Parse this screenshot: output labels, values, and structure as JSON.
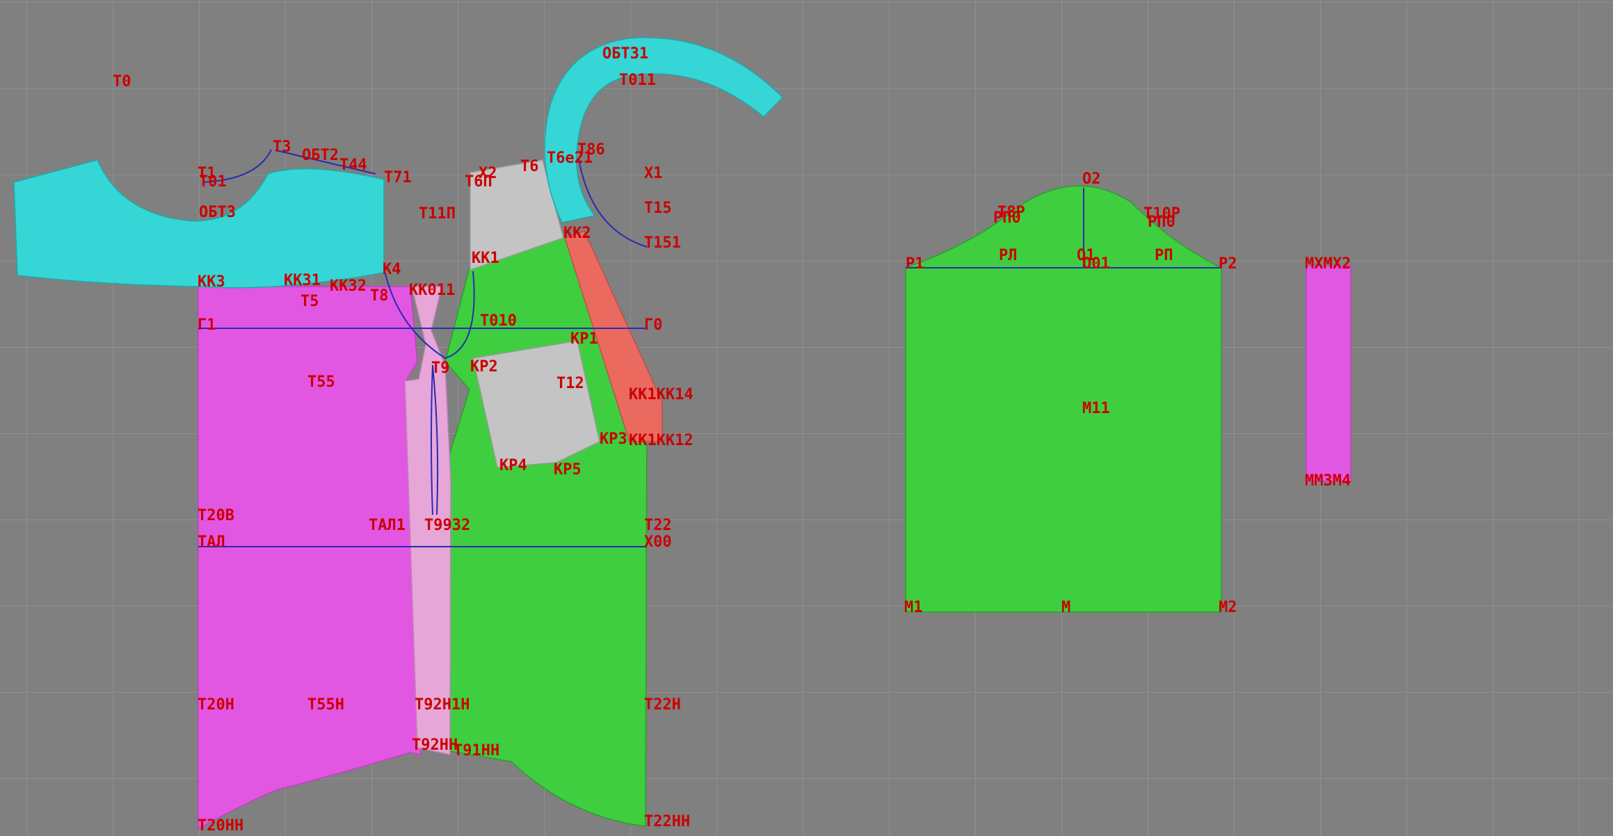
{
  "canvas": {
    "background_color": "#808080",
    "grid_color": "#9a9a9a",
    "label_color": "#cc0000",
    "guide_line_color": "#2a2ab4",
    "colors": {
      "cyan": "#36d6d6",
      "magenta": "#e257e2",
      "green": "#3fce3f",
      "light_gray": "#c4c4c4",
      "salmon": "#ea6a60",
      "pink": "#e6a6d8"
    }
  },
  "pieces": [
    {
      "id": "yoke-back",
      "color": "cyan"
    },
    {
      "id": "back-bodice",
      "color": "magenta"
    },
    {
      "id": "side-panel",
      "color": "pink"
    },
    {
      "id": "front-bodice",
      "color": "green"
    },
    {
      "id": "front-yoke",
      "color": "light_gray"
    },
    {
      "id": "pocket",
      "color": "light_gray"
    },
    {
      "id": "placket",
      "color": "salmon"
    },
    {
      "id": "collar",
      "color": "cyan"
    },
    {
      "id": "sleeve",
      "color": "green"
    },
    {
      "id": "cuff",
      "color": "magenta"
    }
  ],
  "labels": {
    "t0": "T0",
    "t1": "T1",
    "t01": "T01",
    "t3": "T3",
    "obt2": "ОБТ2",
    "t44": "T44",
    "t71": "T71",
    "obt3": "ОБТ3",
    "kk3": "КК3",
    "kk31": "КК31",
    "kk32": "КК32",
    "k4": "К4",
    "t5": "T5",
    "t8": "T8",
    "kk011": "КК011",
    "t11p": "T11П",
    "x2": "Х2",
    "t6": "T6",
    "t6p": "T6П",
    "t6e21": "T6e21",
    "t86": "T86",
    "obt31": "ОБТ31",
    "t011": "T011",
    "x1": "Х1",
    "t15": "T15",
    "t151": "T151",
    "kk2": "КК2",
    "kk1": "КК1",
    "t010": "T010",
    "g1": "Г1",
    "g0": "Г0",
    "kp1": "КР1",
    "t9": "T9",
    "kp2": "КР2",
    "t55": "T55",
    "t12": "T12",
    "kk14": "КК1КК14",
    "kp3": "КР3",
    "kk12": "КК1КК12",
    "kp4": "КР4",
    "kp5": "КР5",
    "t20v": "T20В",
    "tal1": "ТАЛ1",
    "t932": "T9932",
    "t22": "T22",
    "tal": "ТАЛ",
    "x00": "Х00",
    "t20h": "T20Н",
    "t55h": "T55Н",
    "t92h": "T92Н1Н",
    "t22h": "T22Н",
    "t92hh": "T92НН",
    "t91hh": "T91НН",
    "t20hh": "T20НН",
    "t22hh": "T22НН",
    "o2": "О2",
    "t8p": "T8Р",
    "pp0": "РП0",
    "t10p": "T10Р",
    "rp0": "РП0",
    "p1": "Р1",
    "pl": "РЛ",
    "o1": "О1",
    "o01": "О01",
    "pp": "РП",
    "p2": "Р2",
    "m11": "М11",
    "m1": "М1",
    "m": "М",
    "m2": "М2",
    "mx": "МХМХ2",
    "mm": "ММ3М4"
  }
}
